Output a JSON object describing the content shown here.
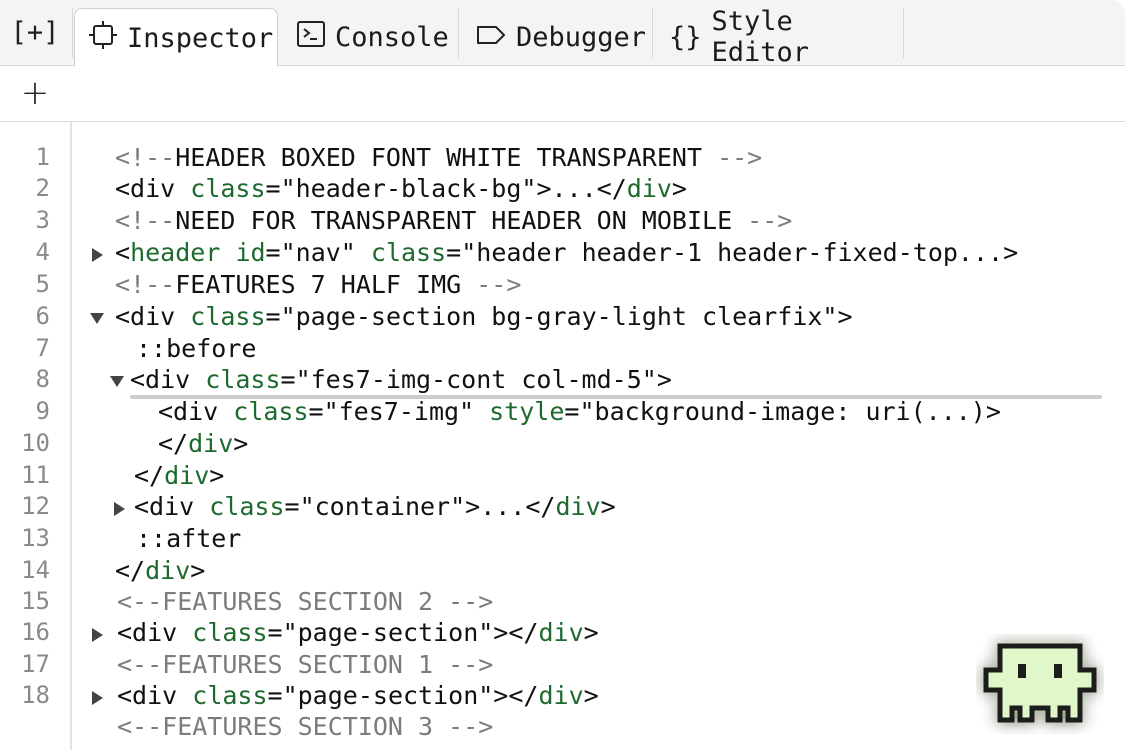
{
  "tabbar": {
    "frames_label": "[+]",
    "tabs": [
      {
        "label": "Inspector",
        "icon": "inspector-icon",
        "active": true
      },
      {
        "label": "Console",
        "icon": "console-icon",
        "active": false
      },
      {
        "label": "Debugger",
        "icon": "debugger-icon",
        "active": false
      },
      {
        "label": "Style Editor",
        "icon": "style-editor-icon",
        "active": false
      }
    ]
  },
  "toolbar": {
    "add_label": "+"
  },
  "markup": {
    "lines": [
      {
        "n": "1",
        "parts": [
          [
            "c",
            "<!--"
          ],
          [
            "t",
            "HEADER BOXED FONT WHITE TRANSPARENT "
          ],
          [
            "c",
            "-->"
          ]
        ]
      },
      {
        "n": "2",
        "parts": [
          [
            "t",
            "<div "
          ],
          [
            "a",
            "class"
          ],
          [
            "t",
            "=\"header-black-bg\">...</"
          ],
          [
            "a",
            "div"
          ],
          [
            "t",
            ">"
          ]
        ]
      },
      {
        "n": "3",
        "parts": [
          [
            "c",
            "<!--"
          ],
          [
            "t",
            "NEED FOR TRANSPARENT HEADER ON MOBILE "
          ],
          [
            "c",
            "-->"
          ]
        ]
      },
      {
        "n": "4",
        "parts": [
          [
            "t",
            "<"
          ],
          [
            "a",
            "header"
          ],
          [
            "t",
            " "
          ],
          [
            "a",
            "id"
          ],
          [
            "t",
            "=\"nav\" "
          ],
          [
            "a",
            "class"
          ],
          [
            "t",
            "=\"header header-1 header-fixed-top...>"
          ]
        ]
      },
      {
        "n": "5",
        "parts": [
          [
            "c",
            "<!--"
          ],
          [
            "t",
            "FEATURES 7 HALF IMG "
          ],
          [
            "c",
            "-->"
          ]
        ]
      },
      {
        "n": "6",
        "parts": [
          [
            "t",
            "<div "
          ],
          [
            "a",
            "class"
          ],
          [
            "t",
            "=\"page-section bg-gray-light clearfix\">"
          ]
        ]
      },
      {
        "n": "7",
        "parts": [
          [
            "t",
            "::before"
          ]
        ]
      },
      {
        "n": "8",
        "parts": [
          [
            "t",
            "<div "
          ],
          [
            "a",
            "class"
          ],
          [
            "t",
            "=\"fes7-img-cont col-md-5\">"
          ]
        ]
      },
      {
        "n": "9",
        "parts": [
          [
            "t",
            "<div "
          ],
          [
            "a",
            "class"
          ],
          [
            "t",
            "=\"fes7-img\" "
          ],
          [
            "a",
            "style"
          ],
          [
            "t",
            "=\"background-image: uri(...)>"
          ]
        ]
      },
      {
        "n": "10",
        "parts": [
          [
            "t",
            "</"
          ],
          [
            "a",
            "div"
          ],
          [
            "t",
            ">"
          ]
        ]
      },
      {
        "n": "11",
        "parts": [
          [
            "t",
            "</"
          ],
          [
            "a",
            "div"
          ],
          [
            "t",
            ">"
          ]
        ]
      },
      {
        "n": "12",
        "parts": [
          [
            "t",
            "<div "
          ],
          [
            "a",
            "class"
          ],
          [
            "t",
            "=\"container\">...</"
          ],
          [
            "a",
            "div"
          ],
          [
            "t",
            ">"
          ]
        ]
      },
      {
        "n": "13",
        "parts": [
          [
            "t",
            "::after"
          ]
        ]
      },
      {
        "n": "14",
        "parts": [
          [
            "t",
            "</"
          ],
          [
            "a",
            "div"
          ],
          [
            "t",
            ">"
          ]
        ]
      },
      {
        "n": "15",
        "parts": [
          [
            "c",
            "<--FEATURES SECTION 2 -->"
          ]
        ]
      },
      {
        "n": "16",
        "parts": [
          [
            "t",
            "<div "
          ],
          [
            "a",
            "class"
          ],
          [
            "t",
            "=\"page-section\"></"
          ],
          [
            "a",
            "div"
          ],
          [
            "t",
            ">"
          ]
        ]
      },
      {
        "n": "17",
        "parts": [
          [
            "c",
            "<--FEATURES SECTION 1 -->"
          ]
        ]
      },
      {
        "n": "18",
        "parts": [
          [
            "t",
            "<div "
          ],
          [
            "a",
            "class"
          ],
          [
            "t",
            "=\"page-section\"></"
          ],
          [
            "a",
            "div"
          ],
          [
            "t",
            ">"
          ]
        ]
      },
      {
        "n": "",
        "parts": [
          [
            "c",
            "<--FEATURES SECTION 3 -->"
          ]
        ]
      }
    ]
  },
  "colors": {
    "attribute": "#1e6a2e",
    "comment": "#7c7c7c",
    "mascot_glow": "#7fe35a"
  },
  "mascot": {
    "icon": "space-invader-mascot-icon"
  }
}
